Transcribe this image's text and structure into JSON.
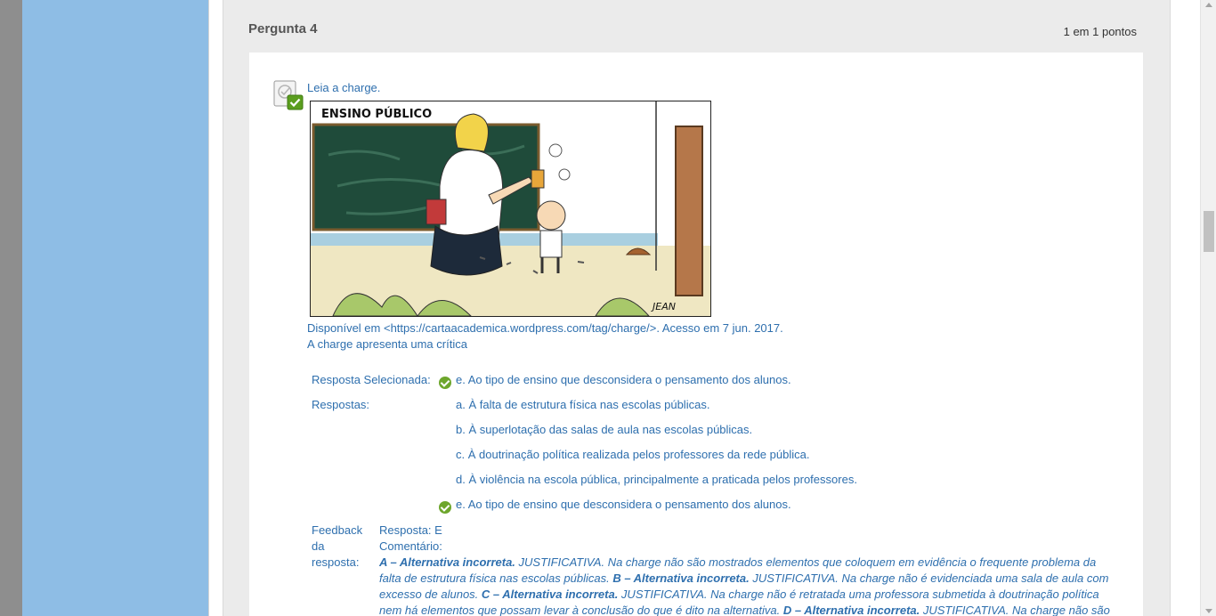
{
  "question": {
    "title": "Pergunta 4",
    "points": "1 em 1 pontos",
    "intro": "Leia a charge.",
    "cartoon_caption": "ENSINO PÚBLICO",
    "cartoon_signature": "JEAN",
    "source": "Disponível em <https://cartaacademica.wordpress.com/tag/charge/>. Acesso em 7 jun. 2017.",
    "prompt": "A charge apresenta uma crítica"
  },
  "answer": {
    "selected_label": "Resposta Selecionada:",
    "selected_value": "e. Ao tipo de ensino que desconsidera o pensamento dos alunos.",
    "answers_label": "Respostas:",
    "options": [
      "a. À falta de estrutura física nas escolas públicas.",
      "b. À superlotação das salas de aula nas escolas públicas.",
      "c. À doutrinação política realizada pelos professores da rede pública.",
      "d. À violência na escola pública, principalmente a praticada pelos professores.",
      "e. Ao tipo de ensino que desconsidera o pensamento dos alunos."
    ]
  },
  "feedback": {
    "label_line1": "Feedback",
    "label_line2": "da",
    "label_line3": "resposta:",
    "answer_line": "Resposta: E",
    "comment_label": "Comentário:",
    "a_title": "A – Alternativa incorreta.",
    "a_text": " JUSTIFICATIVA. Na charge não são mostrados elementos que coloquem em evidência o frequente problema da falta de estrutura física nas escolas públicas. ",
    "b_title": "B – Alternativa incorreta.",
    "b_text": " JUSTIFICATIVA. Na charge não é evidenciada uma sala de aula com excesso de alunos. ",
    "c_title": "C – Alternativa incorreta.",
    "c_text": " JUSTIFICATIVA. Na charge não é retratada uma professora submetida à doutrinação política nem há elementos que possam levar à conclusão do que é dito na alternativa. ",
    "d_title": "D – Alternativa incorreta.",
    "d_text": " JUSTIFICATIVA. Na charge não são mostradas"
  },
  "colors": {
    "link_blue": "#2e6fae",
    "check_green": "#6da62c",
    "sidebar_blue": "#8ebde5",
    "panel_gray": "#ebebeb"
  }
}
